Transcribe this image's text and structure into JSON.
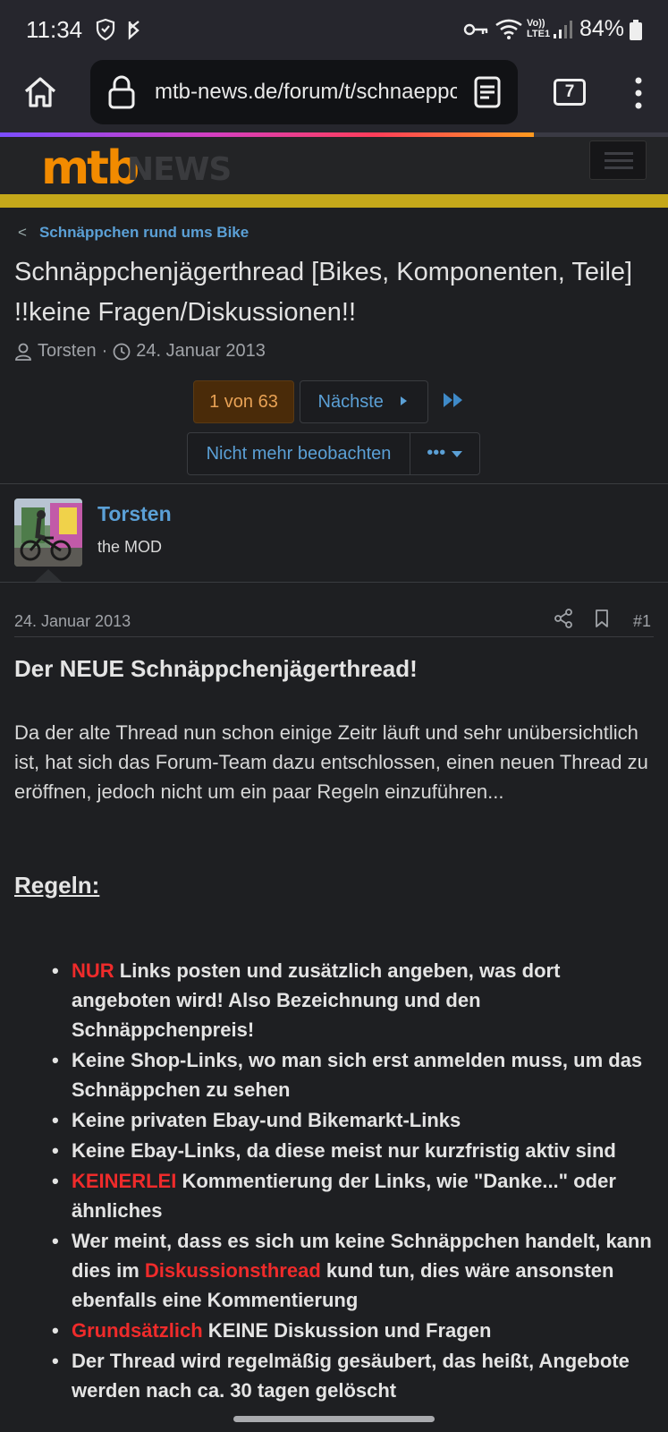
{
  "status_bar": {
    "time": "11:34",
    "battery": "84%",
    "network": "LTE1"
  },
  "browser": {
    "url": "mtb-news.de/forum/t/schnaeppchenjaegerthread",
    "tab_count": "7"
  },
  "site": {
    "logo_part1": "mtb",
    "logo_part2": "NEWS",
    "accent": "#f28b00",
    "stripe_color": "#c5a81a"
  },
  "thread": {
    "breadcrumb": "Schnäppchen rund ums Bike",
    "title": "Schnäppchenjägerthread [Bikes, Komponenten, Teile] !!keine Fragen/Diskussionen!!",
    "author": "Torsten",
    "date": "24. Januar 2013",
    "pager_current": "1 von 63",
    "pager_next": "Nächste",
    "unwatch": "Nicht mehr beobachten",
    "more": "•••"
  },
  "post": {
    "author": "Torsten",
    "user_title": "the MOD",
    "date": "24. Januar 2013",
    "number": "#1",
    "heading": "Der NEUE Schnäppchenjägerthread!",
    "intro": "Da der alte Thread nun schon einige Zeitr läuft und sehr unübersichtlich ist, hat sich das Forum-Team dazu entschlossen, einen neuen Thread zu eröffnen, jedoch nicht um ein paar Regeln einzuführen...",
    "rules_heading": "Regeln:",
    "rules": [
      {
        "red": "NUR",
        "pre": "",
        "post": " Links posten und zusätzlich angeben, was dort angeboten wird! Also Bezeichnung und den Schnäppchenpreis!"
      },
      {
        "red": "",
        "pre": "Keine Shop-Links, wo man sich erst anmelden muss, um das Schnäppchen zu sehen",
        "post": ""
      },
      {
        "red": "",
        "pre": "Keine privaten Ebay-und Bikemarkt-Links",
        "post": ""
      },
      {
        "red": "",
        "pre": "Keine Ebay-Links, da diese meist nur kurzfristig aktiv sind",
        "post": ""
      },
      {
        "red": "KEINERLEI",
        "pre": "",
        "post": " Kommentierung der Links, wie \"Danke...\" oder ähnliches"
      },
      {
        "red": "Diskussionsthread",
        "pre": "Wer meint, dass es sich um keine Schnäppchen handelt, kann dies im ",
        "post": " kund tun, dies wäre ansonsten ebenfalls eine Kommentierung"
      },
      {
        "red": "Grundsätzlich",
        "pre": "",
        "post": " KEINE Diskussion und Fragen"
      },
      {
        "red": "",
        "pre": "Der Thread wird regelmäßig gesäubert, das heißt, Angebote werden nach ca. 30 tagen gelöscht",
        "post": ""
      }
    ]
  }
}
